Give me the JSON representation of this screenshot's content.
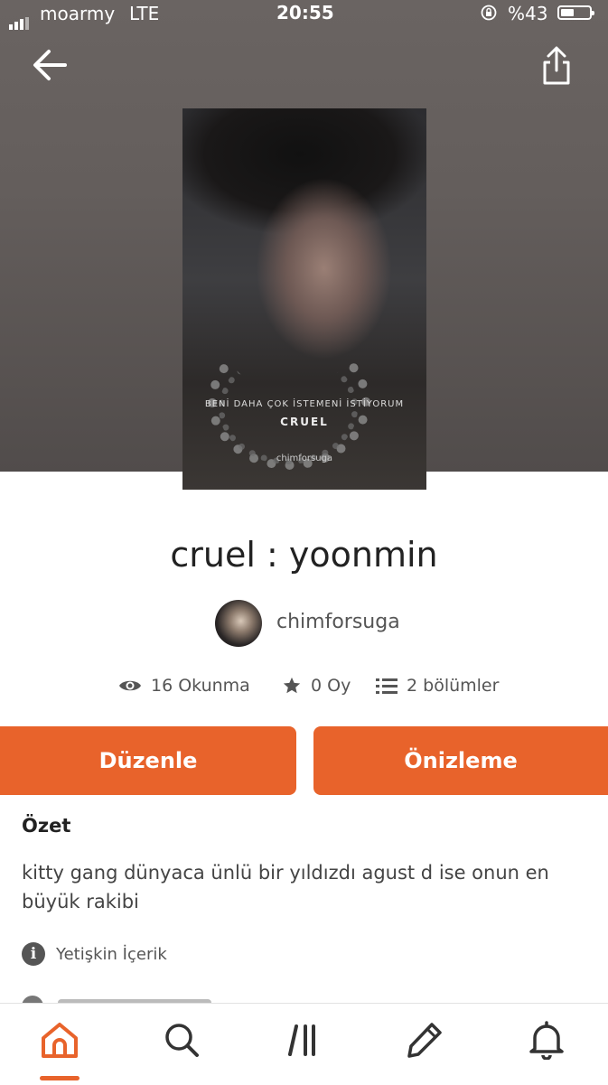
{
  "status_bar": {
    "carrier": "moarmy",
    "network": "LTE",
    "time": "20:55",
    "battery_percent": "%43"
  },
  "cover": {
    "subtitle": "BENİ DAHA ÇOK İSTEMENİ İSTİYORUM",
    "title": "CRUEL",
    "author": "chimforsuga"
  },
  "story": {
    "title": "cruel : yoonmin",
    "author": "chimforsuga"
  },
  "stats": {
    "reads": "16 Okunma",
    "votes": "0 Oy",
    "parts": "2 bölümler"
  },
  "actions": {
    "edit_label": "Düzenle",
    "preview_label": "Önizleme"
  },
  "summary": {
    "heading": "Özet",
    "text": "kitty gang dünyaca ünlü bir yıldızdı agust d ise onun en büyük rakibi",
    "mature_label": "Yetişkin İçerik"
  },
  "colors": {
    "accent": "#e8632b",
    "hero_bg": "#645e5c"
  },
  "nav": {
    "items": [
      "home-icon",
      "search-icon",
      "library-icon",
      "write-icon",
      "notifications-icon"
    ],
    "active": "home-icon"
  }
}
